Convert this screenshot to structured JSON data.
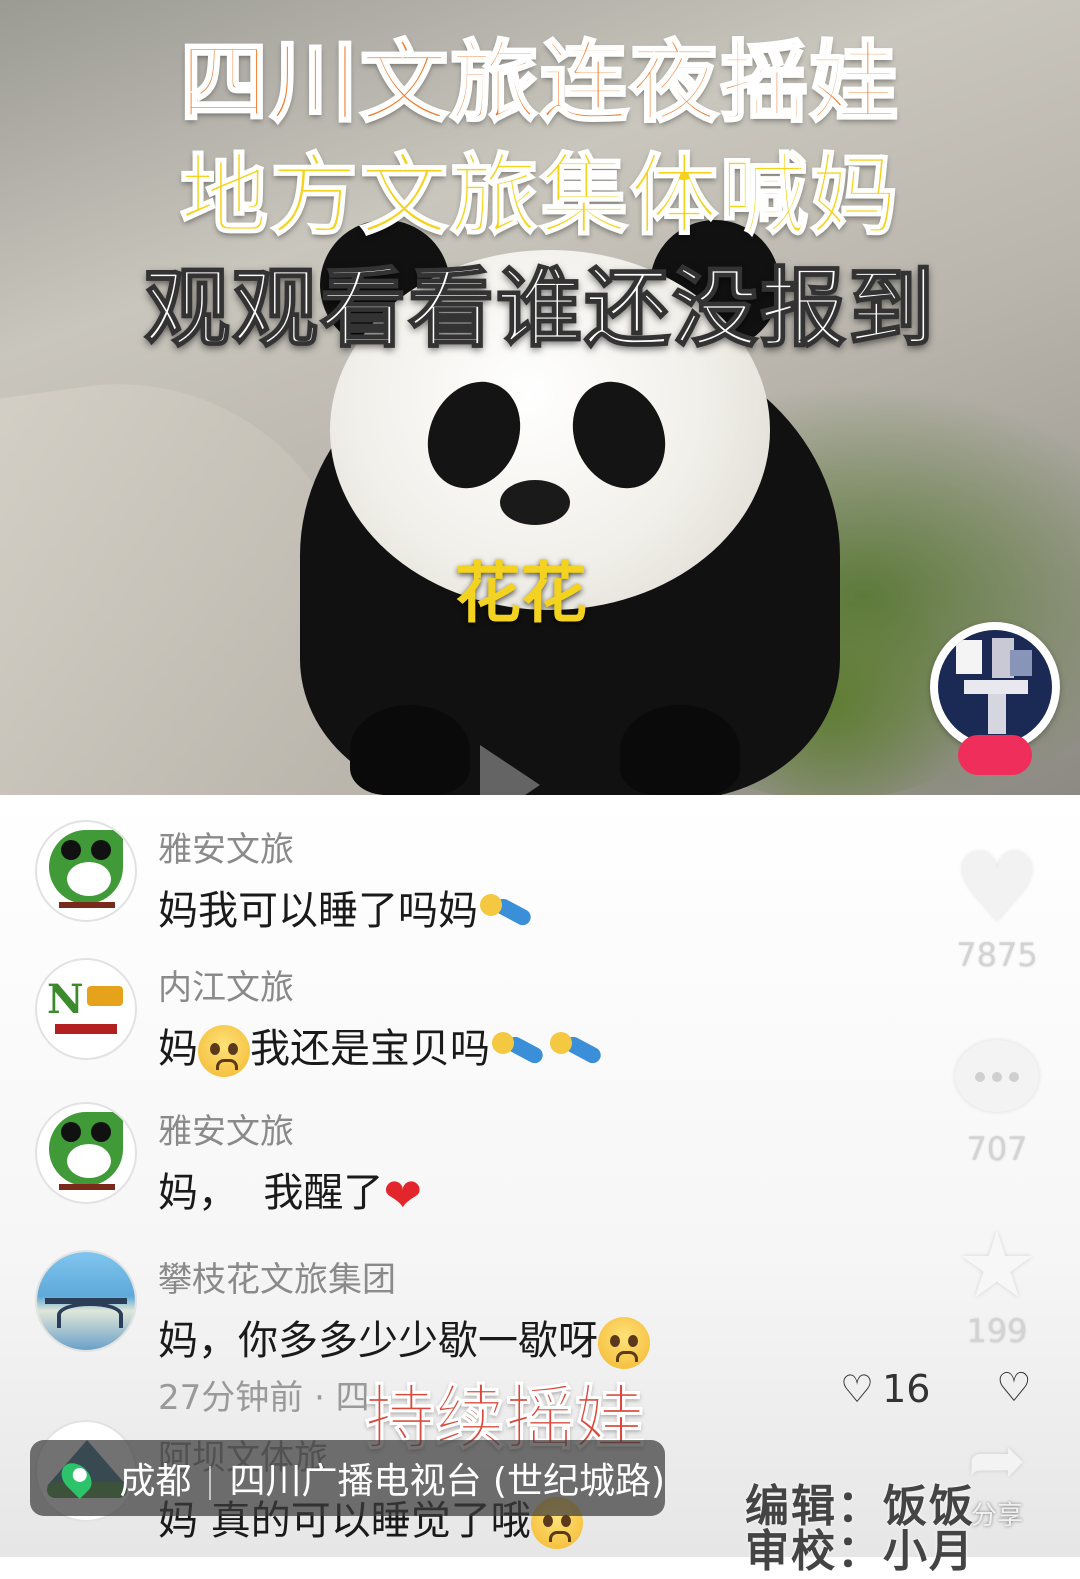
{
  "video": {
    "caption_line1": "四川文旅连夜摇娃",
    "caption_line2": "地方文旅集体喊妈",
    "caption_line3": "观观看看谁还没报到",
    "panda_name": "花花"
  },
  "comments": [
    {
      "author": "雅安文旅",
      "text": "妈我可以睡了吗妈",
      "emojis": [
        "doll"
      ],
      "logo": "yaan-logo"
    },
    {
      "author": "内江文旅",
      "text_before": "妈",
      "text_after": "我还是宝贝吗",
      "emojis": [
        "cry",
        "doll",
        "doll"
      ],
      "logo": "neijiang-logo"
    },
    {
      "author": "雅安文旅",
      "text": "妈，  我醒了",
      "emojis": [
        "heart"
      ],
      "logo": "yaan-logo"
    },
    {
      "author": "攀枝花文旅集团",
      "text": "妈，你多多少少歇一歇呀",
      "emojis": [
        "cry"
      ],
      "logo": "panzhihua-logo"
    }
  ],
  "comment_meta": {
    "time": "27分钟前 · 四",
    "likes": "16"
  },
  "partial_comment": {
    "author": "阿坝文体旅",
    "text": "妈 真的可以睡觉了哦"
  },
  "actions": {
    "like_count": "7875",
    "comment_count": "707",
    "favorite_count": "199",
    "share_label": "分享"
  },
  "overlay": {
    "sticker_text": "持续摇娃"
  },
  "location": {
    "city": "成都",
    "place": "四川广播电视台 (世纪城路)"
  },
  "credits": {
    "editor": "编辑：饭饭",
    "reviewer": "审校：小月"
  },
  "colors": {
    "caption_orange": "#f07a2a",
    "caption_yellow": "#f6d21a",
    "accent_red": "#d9483a",
    "pin_green": "#2cc36b"
  }
}
